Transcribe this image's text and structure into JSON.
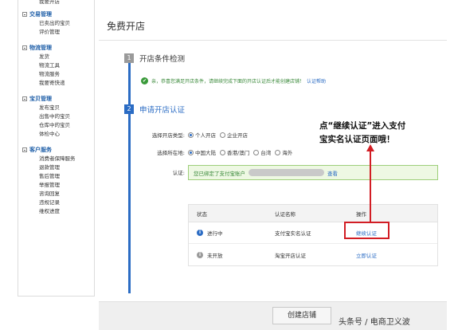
{
  "sidebar": {
    "top_item": "我要开店",
    "groups": [
      {
        "title": "交易管理",
        "items": [
          "已卖出的宝贝",
          "评价管理"
        ]
      },
      {
        "title": "物流管理",
        "items": [
          "发货",
          "物流工具",
          "物流服务",
          "我要寄快递"
        ]
      },
      {
        "title": "宝贝管理",
        "items": [
          "发布宝贝",
          "出售中的宝贝",
          "仓库中的宝贝",
          "体检中心"
        ]
      },
      {
        "title": "客户服务",
        "items": [
          "消费者保障服务",
          "退款管理",
          "售后管理",
          "举报管理",
          "咨询回复",
          "违规记录",
          "维权进度"
        ]
      }
    ]
  },
  "main": {
    "page_title": "免费开店",
    "step1": {
      "num": "1",
      "title": "开店条件检测",
      "check_text": "亲，恭喜您满足开店条件，请继续完成下面的开店认证后才能创建店铺！",
      "check_link": "认证帮助"
    },
    "step2": {
      "num": "2",
      "title": "申请开店认证",
      "shop_type_label": "选择开店类型:",
      "shop_type_options": [
        "个人开店",
        "企业开店"
      ],
      "location_label": "选择所在地:",
      "location_options": [
        "中国大陆",
        "香港/澳门",
        "台湾",
        "海外"
      ],
      "auth_label": "认证:",
      "alipay_text": "您已绑定了支付宝账户",
      "alipay_link": "查看"
    },
    "table": {
      "headers": [
        "状态",
        "认证名称",
        "操作"
      ],
      "rows": [
        {
          "status": "进行中",
          "name": "支付宝实名认证",
          "action": "继续认证",
          "icon": "i"
        },
        {
          "status": "未开放",
          "name": "淘宝开店认证",
          "action": "立即认证",
          "icon": "i"
        }
      ]
    },
    "create_button": "创建店铺"
  },
  "annotation": {
    "line1": "点“继续认证”进入支付",
    "line2": "宝实名认证页面哦！"
  },
  "watermark": "头条号 / 电商卫义波",
  "colors": {
    "accent": "#2b6cc4",
    "annotation_red": "#d21d24",
    "success_green": "#3a9a3a"
  }
}
